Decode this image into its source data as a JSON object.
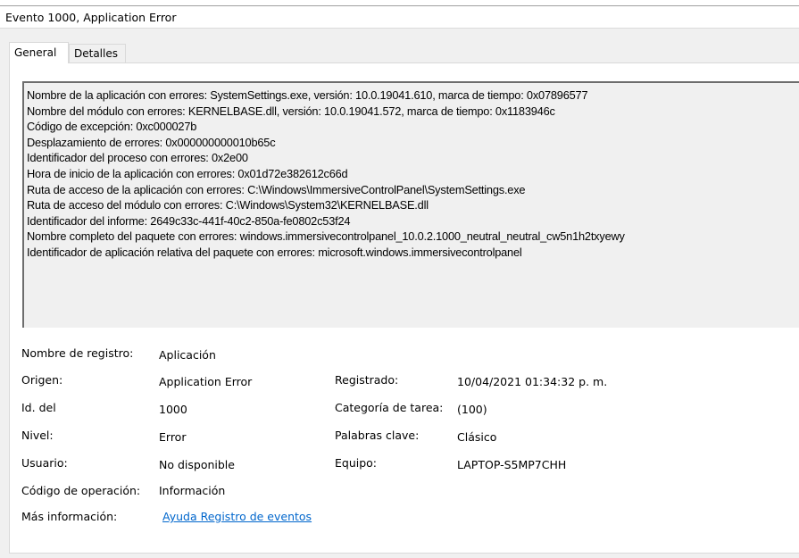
{
  "window": {
    "title": "Evento 1000, Application Error"
  },
  "tabs": [
    {
      "label": "General",
      "active": true
    },
    {
      "label": "Detalles",
      "active": false
    }
  ],
  "description": {
    "lines": [
      "Nombre de la aplicación con errores: SystemSettings.exe, versión: 10.0.19041.610, marca de tiempo: 0x07896577",
      "Nombre del módulo con errores: KERNELBASE.dll, versión: 10.0.19041.572, marca de tiempo: 0x1183946c",
      "Código de excepción: 0xc000027b",
      "Desplazamiento de errores: 0x000000000010b65c",
      "Identificador del proceso con errores: 0x2e00",
      "Hora de inicio de la aplicación con errores: 0x01d72e382612c66d",
      "Ruta de acceso de la aplicación con errores: C:\\Windows\\ImmersiveControlPanel\\SystemSettings.exe",
      "Ruta de acceso del módulo con errores: C:\\Windows\\System32\\KERNELBASE.dll",
      "Identificador del informe: 2649c33c-441f-40c2-850a-fe0802c53f24",
      "Nombre completo del paquete con errores: windows.immersivecontrolpanel_10.0.2.1000_neutral_neutral_cw5n1h2txyewy",
      "Identificador de aplicación relativa del paquete con errores: microsoft.windows.immersivecontrolpanel"
    ]
  },
  "fields": {
    "log_name": {
      "label": "Nombre de registro:",
      "value": "Aplicación"
    },
    "source": {
      "label": "Origen:",
      "value": "Application Error"
    },
    "event_id": {
      "label": "Id. del",
      "value": "1000"
    },
    "level": {
      "label": "Nivel:",
      "value": "Error"
    },
    "user": {
      "label": "Usuario:",
      "value": "No disponible"
    },
    "opcode": {
      "label": "Código de operación:",
      "value": "Información"
    },
    "more_info": {
      "label": "Más información:",
      "link": "Ayuda Registro de eventos"
    },
    "logged": {
      "label": "Registrado:",
      "value": "10/04/2021 01:34:32 p. m."
    },
    "task_category": {
      "label": "Categoría de tarea:",
      "value": "(100)"
    },
    "keywords": {
      "label": "Palabras clave:",
      "value": "Clásico"
    },
    "computer": {
      "label": "Equipo:",
      "value": "LAPTOP-S5MP7CHH"
    }
  }
}
